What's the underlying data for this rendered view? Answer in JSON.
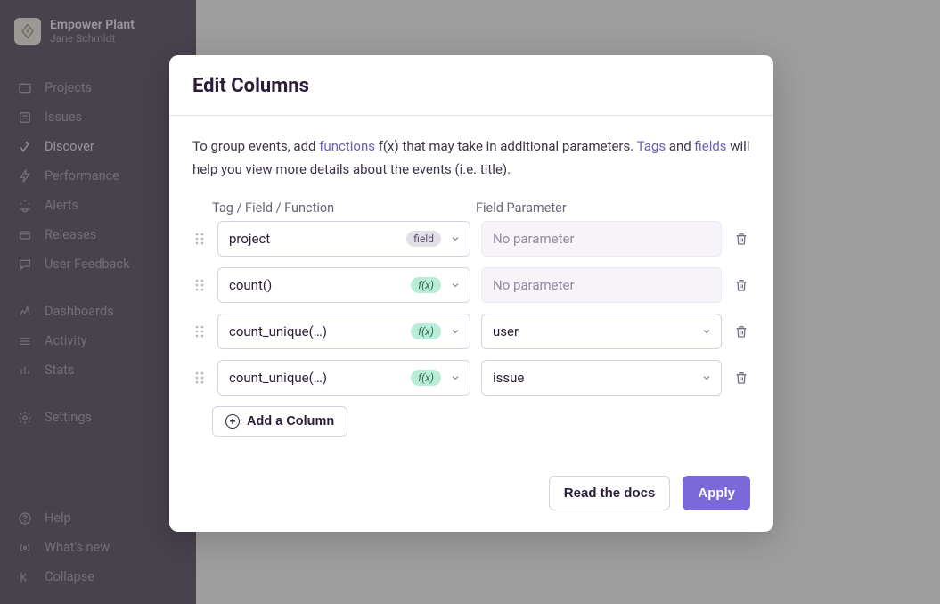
{
  "org": {
    "name": "Empower Plant",
    "user": "Jane Schmidt"
  },
  "nav": {
    "items": [
      {
        "label": "Projects"
      },
      {
        "label": "Issues"
      },
      {
        "label": "Discover"
      },
      {
        "label": "Performance"
      },
      {
        "label": "Alerts"
      },
      {
        "label": "Releases"
      },
      {
        "label": "User Feedback"
      }
    ],
    "group2": [
      {
        "label": "Dashboards"
      },
      {
        "label": "Activity"
      },
      {
        "label": "Stats"
      }
    ],
    "group3": [
      {
        "label": "Settings"
      }
    ],
    "footer": [
      {
        "label": "Help"
      },
      {
        "label": "What's new"
      },
      {
        "label": "Collapse"
      }
    ]
  },
  "modal": {
    "title": "Edit Columns",
    "intro": {
      "before_func": "To group events, add ",
      "functions": "functions",
      "after_func": " f(x) that may take in additional parameters. ",
      "tags": "Tags",
      "and": " and ",
      "fields": "fields",
      "rest": " will help you view more details about the events (i.e. title)."
    },
    "labels": {
      "col1": "Tag / Field / Function",
      "col2": "Field Parameter"
    },
    "rows": [
      {
        "fn": "project",
        "badge": "field",
        "param": "",
        "param_placeholder": "No parameter",
        "param_enabled": false
      },
      {
        "fn": "count()",
        "badge": "fx",
        "param": "",
        "param_placeholder": "No parameter",
        "param_enabled": false
      },
      {
        "fn": "count_unique(…)",
        "badge": "fx",
        "param": "user",
        "param_placeholder": "",
        "param_enabled": true
      },
      {
        "fn": "count_unique(…)",
        "badge": "fx",
        "param": "issue",
        "param_placeholder": "",
        "param_enabled": true
      }
    ],
    "add_column": "Add a Column",
    "footer": {
      "docs": "Read the docs",
      "apply": "Apply"
    },
    "badge_labels": {
      "field": "field",
      "fx": "f(x)"
    }
  }
}
